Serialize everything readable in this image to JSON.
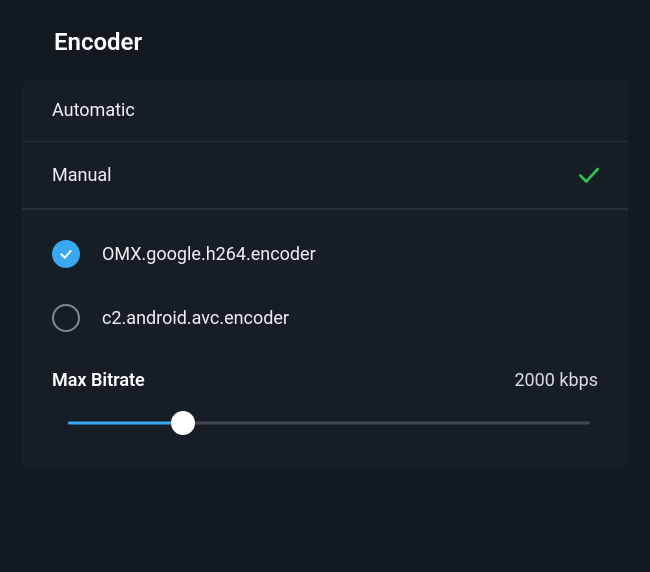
{
  "title": "Encoder",
  "modes": {
    "automatic": {
      "label": "Automatic",
      "selected": false
    },
    "manual": {
      "label": "Manual",
      "selected": true
    }
  },
  "encoders": [
    {
      "name": "OMX.google.h264.encoder",
      "selected": true
    },
    {
      "name": "c2.android.avc.encoder",
      "selected": false
    }
  ],
  "bitrate": {
    "label": "Max Bitrate",
    "value_display": "2000 kbps",
    "percent": 22
  },
  "colors": {
    "accent": "#3aa8f0",
    "check_green": "#2fc24a"
  }
}
